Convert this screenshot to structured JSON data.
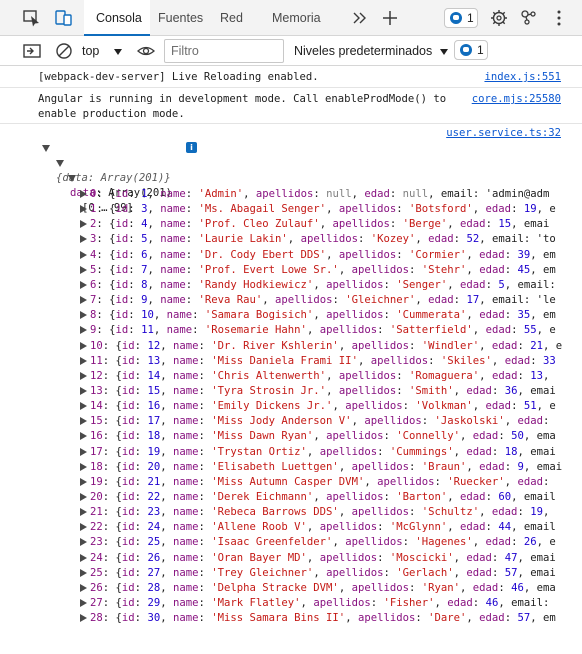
{
  "toolbar": {
    "tabs": [
      {
        "label": "Consola",
        "active": true
      },
      {
        "label": "Fuentes",
        "active": false
      },
      {
        "label": "Red",
        "active": false
      },
      {
        "label": "Memoria",
        "active": false
      }
    ],
    "issues_count": "1"
  },
  "filterbar": {
    "context": "top",
    "filter_placeholder": "Filtro",
    "levels_label": "Niveles predeterminados",
    "issues_count": "1"
  },
  "messages": [
    {
      "text": "[webpack-dev-server] Live Reloading enabled.",
      "source": "index.js:551"
    },
    {
      "text": "Angular is running in development mode. Call enableProdMode() to\nenable production mode.",
      "source": "core.mjs:25580"
    }
  ],
  "log": {
    "source": "user.service.ts:32",
    "root_summary": "{data: Array(201)}",
    "data_key": "data",
    "data_type": "Array(201)",
    "range_label": "[0 … 99]",
    "items": [
      {
        "index": "0",
        "id": "1",
        "name": "'Admin'",
        "apellidos": "null",
        "edad": "null",
        "rest": ", email: 'admin@adm"
      },
      {
        "index": "1",
        "id": "3",
        "name": "'Ms. Abagail Senger'",
        "apellidos": "'Botsford'",
        "edad": "19",
        "rest": ", e"
      },
      {
        "index": "2",
        "id": "4",
        "name": "'Prof. Cleo Zulauf'",
        "apellidos": "'Berge'",
        "edad": "15",
        "rest": ", emai"
      },
      {
        "index": "3",
        "id": "5",
        "name": "'Laurie Lakin'",
        "apellidos": "'Kozey'",
        "edad": "52",
        "rest": ", email: 'to"
      },
      {
        "index": "4",
        "id": "6",
        "name": "'Dr. Cody Ebert DDS'",
        "apellidos": "'Cormier'",
        "edad": "39",
        "rest": ", em"
      },
      {
        "index": "5",
        "id": "7",
        "name": "'Prof. Evert Lowe Sr.'",
        "apellidos": "'Stehr'",
        "edad": "45",
        "rest": ", em"
      },
      {
        "index": "6",
        "id": "8",
        "name": "'Randy Hodkiewicz'",
        "apellidos": "'Senger'",
        "edad": "5",
        "rest": ", email:"
      },
      {
        "index": "7",
        "id": "9",
        "name": "'Reva Rau'",
        "apellidos": "'Gleichner'",
        "edad": "17",
        "rest": ", email: 'le"
      },
      {
        "index": "8",
        "id": "10",
        "name": "'Samara Bogisich'",
        "apellidos": "'Cummerata'",
        "edad": "35",
        "rest": ", em"
      },
      {
        "index": "9",
        "id": "11",
        "name": "'Rosemarie Hahn'",
        "apellidos": "'Satterfield'",
        "edad": "55",
        "rest": ", e"
      },
      {
        "index": "10",
        "id": "12",
        "name": "'Dr. River Kshlerin'",
        "apellidos": "'Windler'",
        "edad": "21",
        "rest": ", e"
      },
      {
        "index": "11",
        "id": "13",
        "name": "'Miss Daniela Frami II'",
        "apellidos": "'Skiles'",
        "edad": "33",
        "rest": ""
      },
      {
        "index": "12",
        "id": "14",
        "name": "'Chris Altenwerth'",
        "apellidos": "'Romaguera'",
        "edad": "13",
        "rest": ","
      },
      {
        "index": "13",
        "id": "15",
        "name": "'Tyra Strosin Jr.'",
        "apellidos": "'Smith'",
        "edad": "36",
        "rest": ", emai"
      },
      {
        "index": "14",
        "id": "16",
        "name": "'Emily Dickens Jr.'",
        "apellidos": "'Volkman'",
        "edad": "51",
        "rest": ", e"
      },
      {
        "index": "15",
        "id": "17",
        "name": "'Miss Jody Anderson V'",
        "apellidos": "'Jaskolski'",
        "edad": "",
        "rest": ""
      },
      {
        "index": "16",
        "id": "18",
        "name": "'Miss Dawn Ryan'",
        "apellidos": "'Connelly'",
        "edad": "50",
        "rest": ", ema"
      },
      {
        "index": "17",
        "id": "19",
        "name": "'Trystan Ortiz'",
        "apellidos": "'Cummings'",
        "edad": "18",
        "rest": ", emai"
      },
      {
        "index": "18",
        "id": "20",
        "name": "'Elisabeth Luettgen'",
        "apellidos": "'Braun'",
        "edad": "9",
        "rest": ", emai"
      },
      {
        "index": "19",
        "id": "21",
        "name": "'Miss Autumn Casper DVM'",
        "apellidos": "'Ruecker'",
        "edad": "",
        "rest": ""
      },
      {
        "index": "20",
        "id": "22",
        "name": "'Derek Eichmann'",
        "apellidos": "'Barton'",
        "edad": "60",
        "rest": ", email"
      },
      {
        "index": "21",
        "id": "23",
        "name": "'Rebeca Barrows DDS'",
        "apellidos": "'Schultz'",
        "edad": "19",
        "rest": ","
      },
      {
        "index": "22",
        "id": "24",
        "name": "'Allene Roob V'",
        "apellidos": "'McGlynn'",
        "edad": "44",
        "rest": ", email"
      },
      {
        "index": "23",
        "id": "25",
        "name": "'Isaac Greenfelder'",
        "apellidos": "'Hagenes'",
        "edad": "26",
        "rest": ", e"
      },
      {
        "index": "24",
        "id": "26",
        "name": "'Oran Bayer MD'",
        "apellidos": "'Moscicki'",
        "edad": "47",
        "rest": ", emai"
      },
      {
        "index": "25",
        "id": "27",
        "name": "'Trey Gleichner'",
        "apellidos": "'Gerlach'",
        "edad": "57",
        "rest": ", emai"
      },
      {
        "index": "26",
        "id": "28",
        "name": "'Delpha Stracke DVM'",
        "apellidos": "'Ryan'",
        "edad": "46",
        "rest": ", ema"
      },
      {
        "index": "27",
        "id": "29",
        "name": "'Mark Flatley'",
        "apellidos": "'Fisher'",
        "edad": "46",
        "rest": ", email:"
      },
      {
        "index": "28",
        "id": "30",
        "name": "'Miss Samara Bins II'",
        "apellidos": "'Dare'",
        "edad": "57",
        "rest": ", em"
      }
    ]
  },
  "colors": {
    "accent": "#0f6cbd",
    "link": "#0b57d0",
    "key": "#881280",
    "string": "#c41a16",
    "number": "#1c00cf"
  }
}
